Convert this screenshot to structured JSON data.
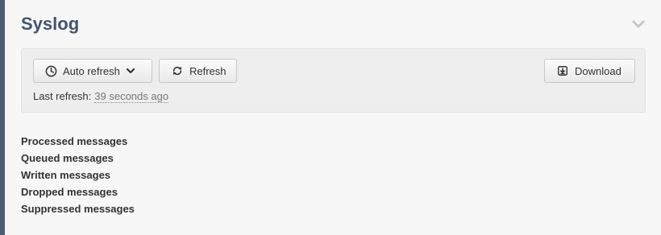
{
  "panel": {
    "title": "Syslog",
    "collapse_icon": "chevron-down-icon"
  },
  "toolbar": {
    "auto_refresh_label": "Auto refresh",
    "refresh_label": "Refresh",
    "download_label": "Download",
    "last_refresh_label": "Last refresh:",
    "last_refresh_value": "39 seconds ago",
    "icons": {
      "auto_refresh": "clock-icon",
      "auto_refresh_caret": "chevron-down-icon",
      "refresh": "refresh-icon",
      "download": "download-icon"
    }
  },
  "stats": {
    "items": [
      "Processed messages",
      "Queued messages",
      "Written messages",
      "Dropped messages",
      "Suppressed messages"
    ]
  },
  "colors": {
    "title": "#44546f",
    "left_rail": "#4b5c76",
    "background": "#f7f7f7",
    "toolbar_bg": "#eeeeee"
  }
}
